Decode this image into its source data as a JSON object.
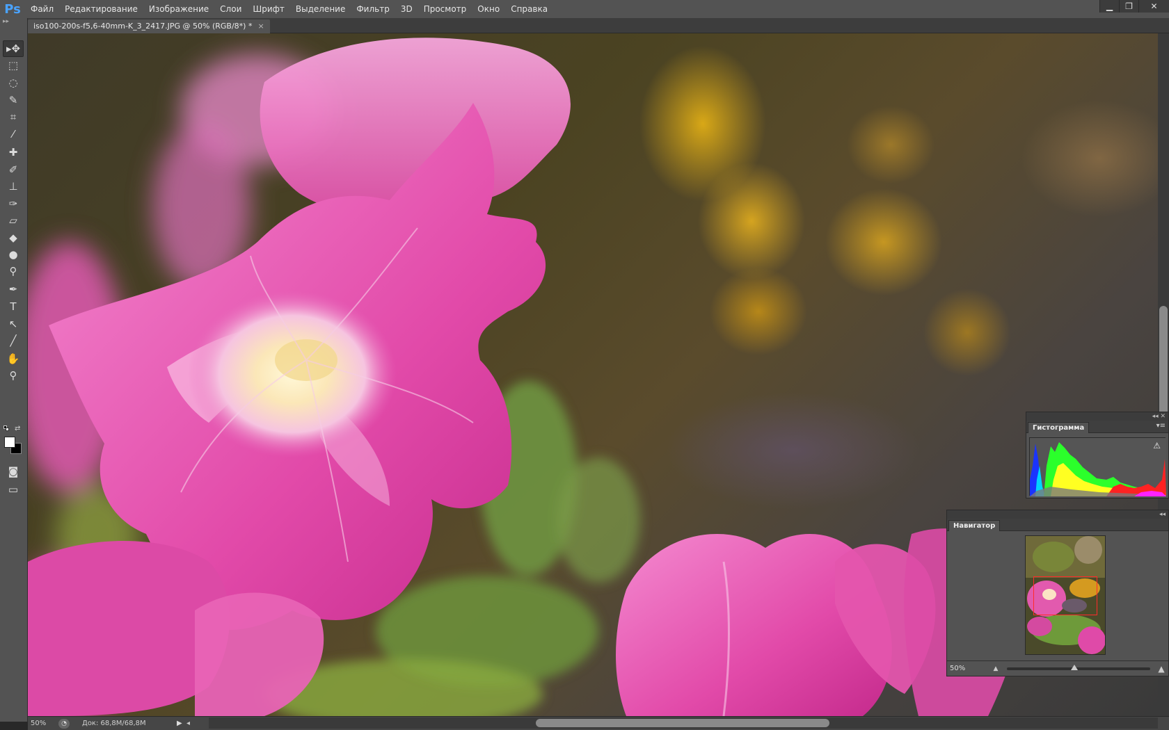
{
  "app": {
    "logo": "Ps"
  },
  "menu": [
    "Файл",
    "Редактирование",
    "Изображение",
    "Слои",
    "Шрифт",
    "Выделение",
    "Фильтр",
    "3D",
    "Просмотр",
    "Окно",
    "Справка"
  ],
  "window_controls": {
    "minimize": "▁",
    "restore": "❐",
    "close": "✕"
  },
  "document": {
    "tab_title": "iso100-200s-f5,6-40mm-K_3_2417.JPG @ 50% (RGB/8*) *",
    "tab_close": "×"
  },
  "toolbar": {
    "grip": "▸▸",
    "tools": [
      {
        "name": "move-tool",
        "glyph": "▸✥",
        "active": true
      },
      {
        "name": "rect-marquee-tool",
        "glyph": "⬚"
      },
      {
        "name": "lasso-tool",
        "glyph": "◌"
      },
      {
        "name": "quick-selection-tool",
        "glyph": "✎"
      },
      {
        "name": "crop-tool",
        "glyph": "⌗"
      },
      {
        "name": "eyedropper-tool",
        "glyph": "⁄"
      },
      {
        "name": "spot-healing-tool",
        "glyph": "✚"
      },
      {
        "name": "brush-tool",
        "glyph": "✐"
      },
      {
        "name": "clone-stamp-tool",
        "glyph": "⊥"
      },
      {
        "name": "history-brush-tool",
        "glyph": "✑"
      },
      {
        "name": "eraser-tool",
        "glyph": "▱"
      },
      {
        "name": "paint-bucket-tool",
        "glyph": "◆"
      },
      {
        "name": "blur-tool",
        "glyph": "●"
      },
      {
        "name": "dodge-tool",
        "glyph": "⚲"
      },
      {
        "name": "pen-tool",
        "glyph": "✒"
      },
      {
        "name": "type-tool",
        "glyph": "T"
      },
      {
        "name": "path-selection-tool",
        "glyph": "↖"
      },
      {
        "name": "line-tool",
        "glyph": "╱"
      },
      {
        "name": "hand-tool",
        "glyph": "✋"
      },
      {
        "name": "zoom-tool",
        "glyph": "⚲"
      }
    ],
    "bottom_tools": [
      {
        "name": "quick-mask-tool",
        "glyph": "◙"
      },
      {
        "name": "screen-mode-tool",
        "glyph": "▭"
      }
    ],
    "swap_glyph": "⇄",
    "fg_color": "#ffffff",
    "bg_color": "#000000"
  },
  "status": {
    "zoom": "50%",
    "icon": "◔",
    "doc_size": "Док: 68,8M/68,8M",
    "arrow": "▶",
    "scroll_left": "◂"
  },
  "histogram": {
    "panel_collapse": "◂◂ ✕",
    "tab": "Гистограмма",
    "menu": "▾≡",
    "warning": "⚠"
  },
  "navigator": {
    "panel_collapse": "◂◂",
    "tab": "Навигатор",
    "zoom_value": "50%",
    "zoom_out": "▲",
    "zoom_in": "▲"
  },
  "colors": {
    "ui_bg": "#535353",
    "ui_dark": "#282828",
    "accent_ps": "#4aa3ff",
    "nav_rect": "#ff2a2a",
    "petal_pink": "#e04aa8"
  }
}
